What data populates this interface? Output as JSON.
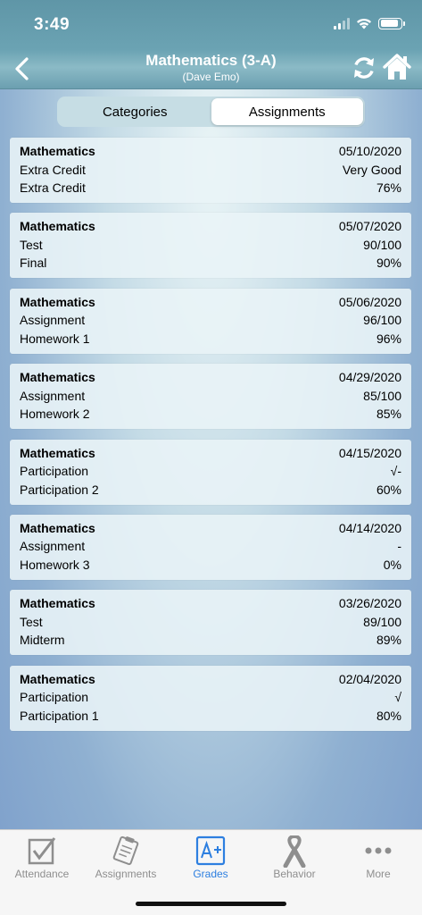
{
  "status_bar": {
    "time": "3:49"
  },
  "nav": {
    "title": "Mathematics  (3-A)",
    "subtitle": "(Dave Emo)"
  },
  "segments": [
    {
      "label": "Categories",
      "selected": false
    },
    {
      "label": "Assignments",
      "selected": true
    }
  ],
  "assignments": [
    {
      "subject": "Mathematics",
      "date": "05/10/2020",
      "type": "Extra Credit",
      "score": "Very Good",
      "name": "Extra Credit",
      "percent": "76%"
    },
    {
      "subject": "Mathematics",
      "date": "05/07/2020",
      "type": "Test",
      "score": "90/100",
      "name": "Final",
      "percent": "90%"
    },
    {
      "subject": "Mathematics",
      "date": "05/06/2020",
      "type": "Assignment",
      "score": "96/100",
      "name": "Homework 1",
      "percent": "96%"
    },
    {
      "subject": "Mathematics",
      "date": "04/29/2020",
      "type": "Assignment",
      "score": "85/100",
      "name": "Homework 2",
      "percent": "85%"
    },
    {
      "subject": "Mathematics",
      "date": "04/15/2020",
      "type": "Participation",
      "score": "√-",
      "name": "Participation 2",
      "percent": "60%"
    },
    {
      "subject": "Mathematics",
      "date": "04/14/2020",
      "type": "Assignment",
      "score": "-",
      "name": "Homework 3",
      "percent": "0%"
    },
    {
      "subject": "Mathematics",
      "date": "03/26/2020",
      "type": "Test",
      "score": "89/100",
      "name": "Midterm",
      "percent": "89%"
    },
    {
      "subject": "Mathematics",
      "date": "02/04/2020",
      "type": "Participation",
      "score": "√",
      "name": "Participation 1",
      "percent": "80%"
    }
  ],
  "tab_bar": {
    "tabs": [
      {
        "label": "Attendance",
        "icon": "checkbox-icon",
        "active": false
      },
      {
        "label": "Assignments",
        "icon": "clipboard-icon",
        "active": false
      },
      {
        "label": "Grades",
        "icon": "grades-a-plus-icon",
        "active": true
      },
      {
        "label": "Behavior",
        "icon": "ribbon-icon",
        "active": false
      },
      {
        "label": "More",
        "icon": "more-dots-icon",
        "active": false
      }
    ]
  },
  "colors": {
    "accent": "#2d7fe0",
    "nav_bg": "#6ba3b3",
    "inactive_tab": "#8e8e8e"
  }
}
